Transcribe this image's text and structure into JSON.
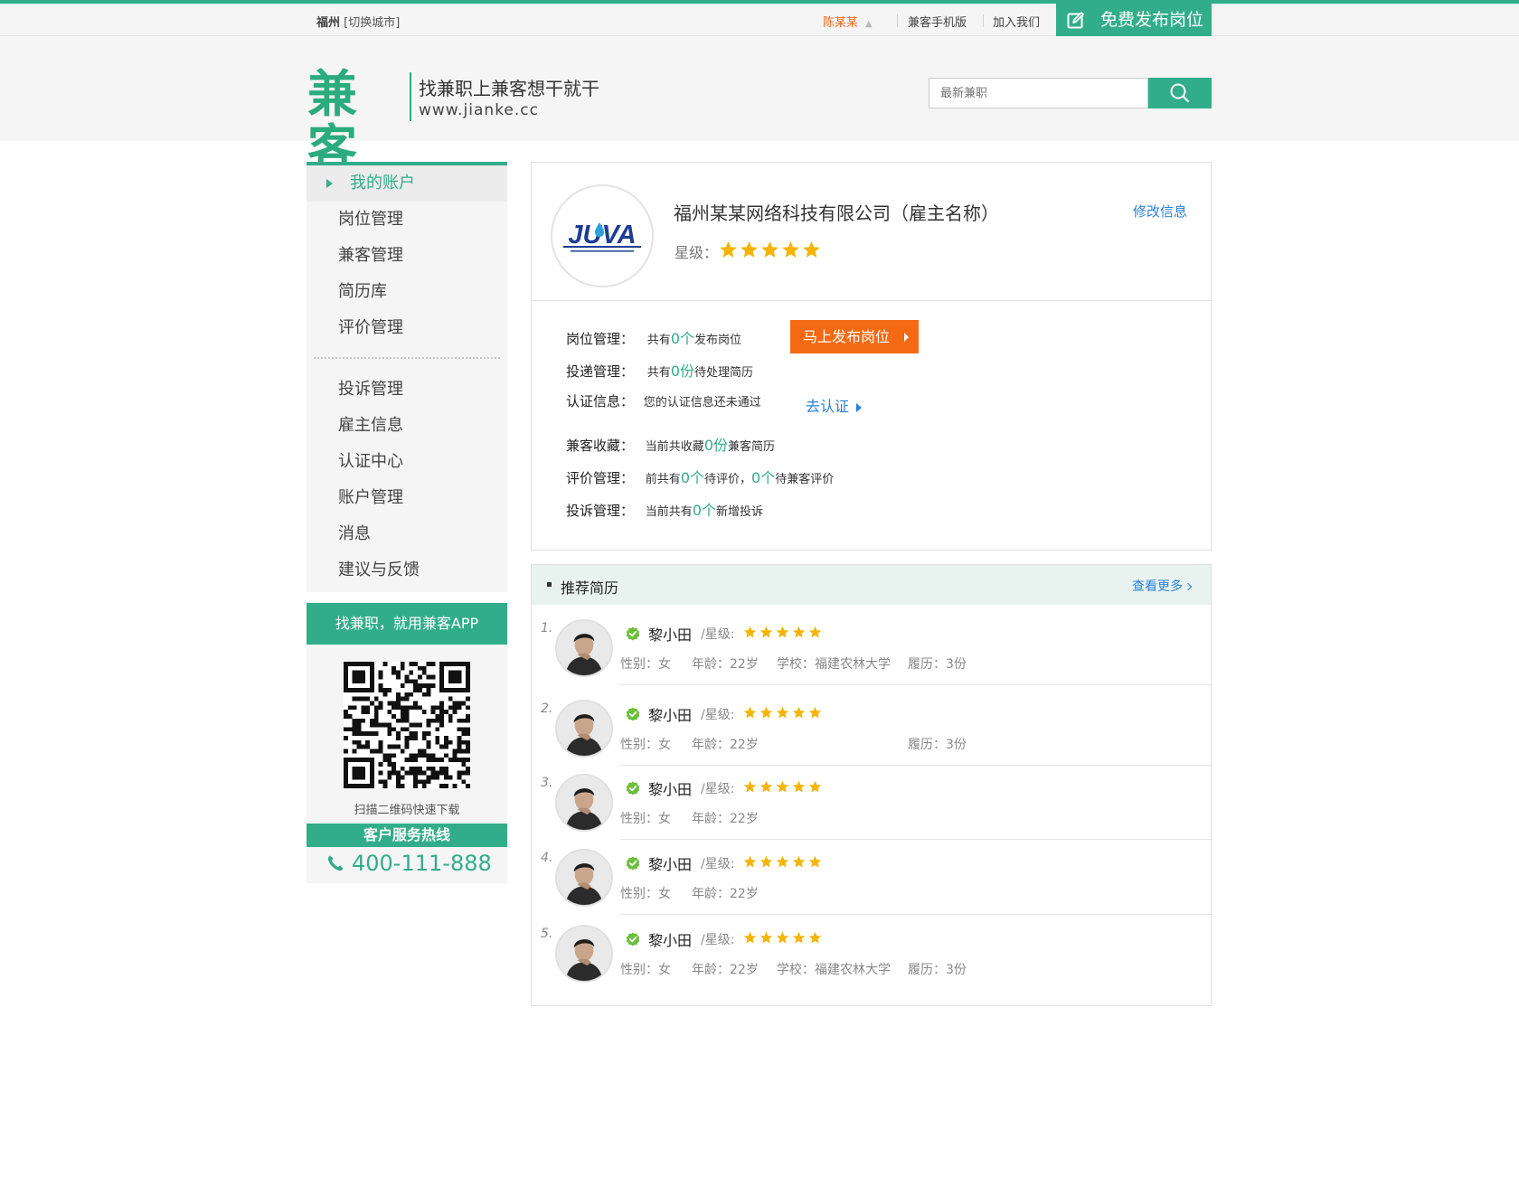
{
  "topbar": {
    "city": "福州",
    "switch_city": "[切换城市]",
    "user": "陈某某",
    "mobile": "兼客手机版",
    "join": "加入我们",
    "post_job": "免费发布岗位"
  },
  "header": {
    "logo": "兼客",
    "slogan": "找兼职上兼客想干就干",
    "url": "www.jianke.cc",
    "search_placeholder": "最新兼职"
  },
  "sidebar": {
    "active": "我的账户",
    "group1": [
      "岗位管理",
      "兼客管理",
      "简历库",
      "评价管理"
    ],
    "group2": [
      "投诉管理",
      "雇主信息",
      "认证中心",
      "账户管理",
      "消息",
      "建议与反馈"
    ],
    "app_banner": "找兼职，就用兼客APP",
    "qr_caption": "扫描二维码快速下载",
    "hotline_title": "客户服务热线",
    "hotline": "400-111-888"
  },
  "profile": {
    "company": "福州某某网络科技有限公司（雇主名称）",
    "edit": "修改信息",
    "rating_label": "星级：",
    "stars": 5,
    "logo_text": "JUVA",
    "rows": {
      "jobs_label": "岗位管理：",
      "jobs_pre": "共有",
      "jobs_n": "0个",
      "jobs_post": "发布岗位",
      "publish_btn": "马上发布岗位",
      "deliver_label": "投递管理：",
      "deliver_pre": "共有",
      "deliver_n": "0份",
      "deliver_post": "待处理简历",
      "auth_label": "认证信息：",
      "auth_text": "您的认证信息还未通过",
      "auth_link": "去认证",
      "fav_label": "兼客收藏：",
      "fav_pre": "当前共收藏",
      "fav_n": "0份",
      "fav_post": "兼客简历",
      "eval_label": "评价管理：",
      "eval_pre": "前共有",
      "eval_n1": "0个",
      "eval_mid": "待评价，",
      "eval_n2": "0个",
      "eval_post": "待兼客评价",
      "comp_label": "投诉管理：",
      "comp_pre": "当前共有",
      "comp_n": "0个",
      "comp_post": "新增投诉"
    }
  },
  "recommend": {
    "title": "推荐简历",
    "more": "查看更多",
    "items": [
      {
        "idx": "1.",
        "name": "黎小田",
        "level": "/星级:",
        "gender": "性别：女",
        "age": "年龄：22岁",
        "school": "学校：福建农林大学",
        "history": "履历：3份"
      },
      {
        "idx": "2.",
        "name": "黎小田",
        "level": "/星级:",
        "gender": "性别：女",
        "age": "年龄：22岁",
        "school": "",
        "history": "履历：3份"
      },
      {
        "idx": "3.",
        "name": "黎小田",
        "level": "/星级:",
        "gender": "性别：女",
        "age": "年龄：22岁",
        "school": "",
        "history": ""
      },
      {
        "idx": "4.",
        "name": "黎小田",
        "level": "/星级:",
        "gender": "性别：女",
        "age": "年龄：22岁",
        "school": "",
        "history": ""
      },
      {
        "idx": "5.",
        "name": "黎小田",
        "level": "/星级:",
        "gender": "性别：女",
        "age": "年龄：22岁",
        "school": "学校：福建农林大学",
        "history": "履历：3份"
      }
    ]
  },
  "colors": {
    "brand": "#32ad8a",
    "orange": "#f46a12",
    "link": "#2a82d6",
    "star": "#f5b400"
  }
}
